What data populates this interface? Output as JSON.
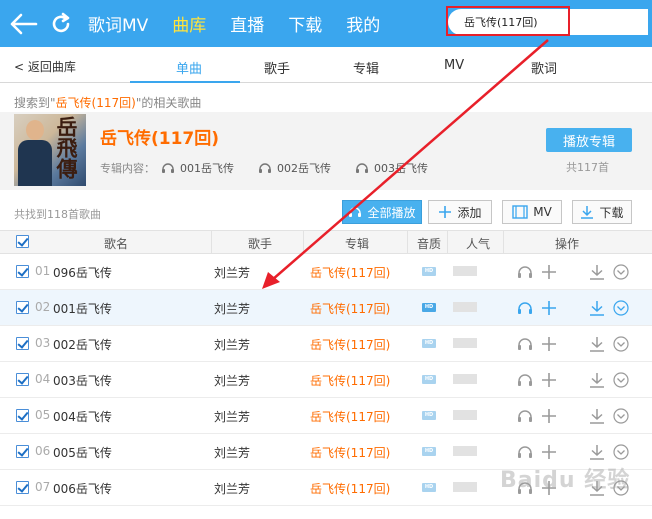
{
  "colors": {
    "accent": "#3aa6ee",
    "highlight": "#ff6c00",
    "active_nav": "#ffe33b",
    "annotation": "#e8202a"
  },
  "nav": {
    "items": [
      {
        "label": "歌词MV",
        "active": false
      },
      {
        "label": "曲库",
        "active": true
      },
      {
        "label": "直播",
        "active": false
      },
      {
        "label": "下载",
        "active": false
      },
      {
        "label": "我的",
        "active": false
      }
    ]
  },
  "search": {
    "value": "岳飞传(117回)"
  },
  "tabs": {
    "back": "< 返回曲库",
    "items": [
      "单曲",
      "歌手",
      "专辑",
      "MV",
      "歌词"
    ],
    "active_index": 0
  },
  "result": {
    "prefix": "搜索到\"",
    "keyword": "岳飞传(117回)",
    "suffix": "\"的相关歌曲"
  },
  "album": {
    "cover_text": "岳飛傳",
    "title": "岳飞传(117回)",
    "content_label": "专辑内容：",
    "tracks": [
      "001岳飞传",
      "002岳飞传",
      "003岳飞传"
    ],
    "play_button": "播放专辑",
    "count": "共117首"
  },
  "toolbar": {
    "found": "共找到118首歌曲",
    "play_all": "全部播放",
    "add": "添加",
    "mv": "MV",
    "download": "下载"
  },
  "table": {
    "headers": {
      "name": "歌名",
      "artist": "歌手",
      "album": "专辑",
      "quality": "音质",
      "popularity": "人气",
      "actions": "操作"
    },
    "rows": [
      {
        "num": "01",
        "name": "096岳飞传",
        "artist": "刘兰芳",
        "album": "岳飞传(117回)",
        "quality": "HD"
      },
      {
        "num": "02",
        "name": "001岳飞传",
        "artist": "刘兰芳",
        "album": "岳飞传(117回)",
        "quality": "HD"
      },
      {
        "num": "03",
        "name": "002岳飞传",
        "artist": "刘兰芳",
        "album": "岳飞传(117回)",
        "quality": "HD"
      },
      {
        "num": "04",
        "name": "003岳飞传",
        "artist": "刘兰芳",
        "album": "岳飞传(117回)",
        "quality": "HD"
      },
      {
        "num": "05",
        "name": "004岳飞传",
        "artist": "刘兰芳",
        "album": "岳飞传(117回)",
        "quality": "HD"
      },
      {
        "num": "06",
        "name": "005岳飞传",
        "artist": "刘兰芳",
        "album": "岳飞传(117回)",
        "quality": "HD"
      },
      {
        "num": "07",
        "name": "006岳飞传",
        "artist": "刘兰芳",
        "album": "岳飞传(117回)",
        "quality": "HD"
      }
    ]
  },
  "watermark": "Baidu 经验"
}
